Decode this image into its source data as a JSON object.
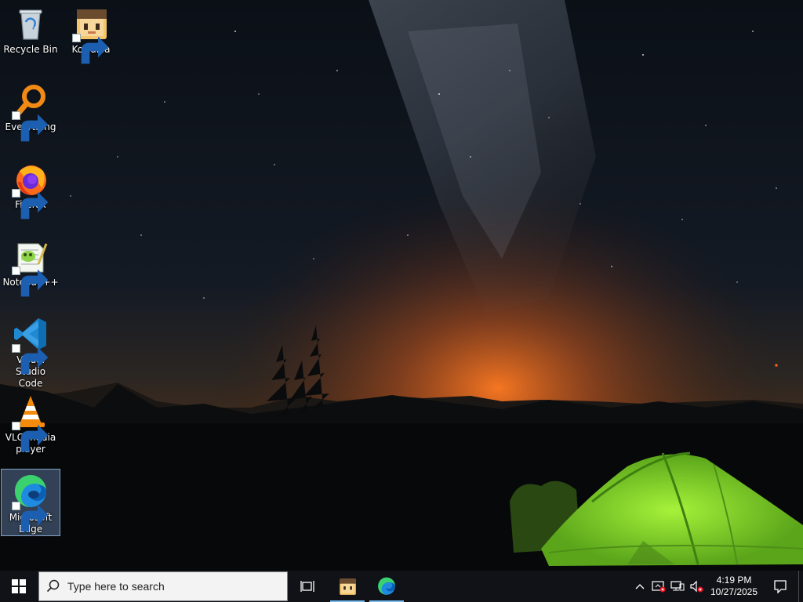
{
  "desktop": {
    "icons": [
      {
        "label": "Recycle Bin",
        "icon": "recycle-bin-icon",
        "shortcut": false
      },
      {
        "label": "KoGaMa",
        "icon": "kogama-icon",
        "shortcut": true
      },
      {
        "label": "Everything",
        "icon": "everything-search-icon",
        "shortcut": true
      },
      {
        "label": "Firefox",
        "icon": "firefox-icon",
        "shortcut": true
      },
      {
        "label": "Notepad++",
        "icon": "notepad-plus-plus-icon",
        "shortcut": true
      },
      {
        "label": "Visual Studio Code",
        "icon": "vscode-icon",
        "shortcut": true
      },
      {
        "label": "VLC media player",
        "icon": "vlc-icon",
        "shortcut": true
      },
      {
        "label": "Microsoft Edge",
        "icon": "edge-icon",
        "shortcut": true,
        "selected": true
      }
    ]
  },
  "taskbar": {
    "search_placeholder": "Type here to search",
    "pinned": [
      {
        "icon": "task-view-icon"
      },
      {
        "icon": "kogama-icon",
        "running": true
      },
      {
        "icon": "edge-icon",
        "running": true
      }
    ],
    "tray": {
      "icons": [
        "chevron-up-icon",
        "security-alert-icon",
        "network-disconnected-icon",
        "volume-muted-icon"
      ],
      "time": "4:19 PM",
      "date": "10/27/2025"
    }
  },
  "colors": {
    "taskbar_bg": "#101217",
    "running_indicator": "#76b9ed",
    "tent": "#8fdc2e",
    "horizon_glow": "#e0601a"
  }
}
